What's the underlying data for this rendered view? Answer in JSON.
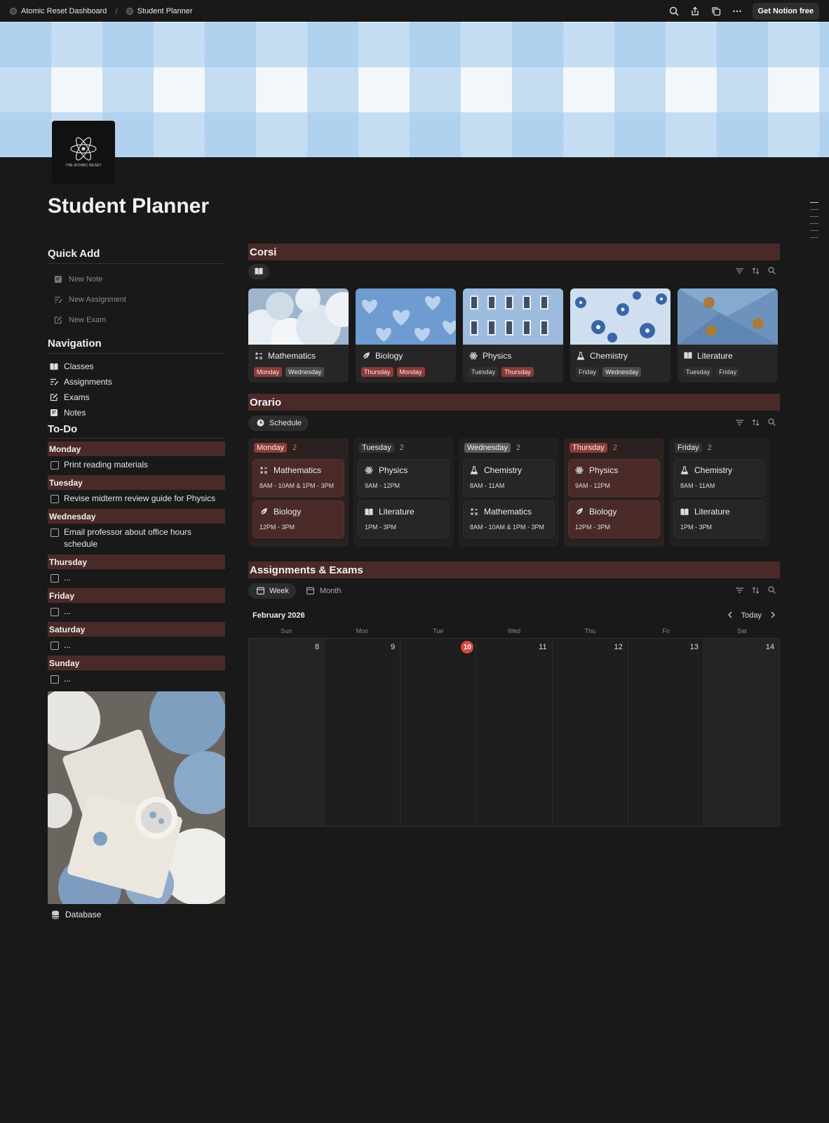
{
  "breadcrumb": {
    "parent": "Atomic Reset Dashboard",
    "current": "Student Planner"
  },
  "topbar": {
    "cta": "Get Notion free"
  },
  "page": {
    "title": "Student Planner",
    "logo_text": "THE ATOMIC RESET"
  },
  "quick_add": {
    "heading": "Quick Add",
    "items": [
      {
        "label": "New Note",
        "icon": "note-icon"
      },
      {
        "label": "New Assignment",
        "icon": "list-edit-icon"
      },
      {
        "label": "New Exam",
        "icon": "pencil-square-icon"
      }
    ]
  },
  "navigation": {
    "heading": "Navigation",
    "items": [
      {
        "label": "Classes",
        "icon": "book-icon"
      },
      {
        "label": "Assignments",
        "icon": "list-edit-icon"
      },
      {
        "label": "Exams",
        "icon": "pencil-square-icon"
      },
      {
        "label": "Notes",
        "icon": "note-icon"
      }
    ]
  },
  "todo": {
    "heading": "To-Do",
    "days": [
      {
        "day": "Monday",
        "tasks": [
          "Print reading materials"
        ]
      },
      {
        "day": "Tuesday",
        "tasks": [
          "Revise midterm review guide for Physics"
        ]
      },
      {
        "day": "Wednesday",
        "tasks": [
          "Email professor about office hours schedule"
        ]
      },
      {
        "day": "Thursday",
        "tasks": [
          "..."
        ]
      },
      {
        "day": "Friday",
        "tasks": [
          "..."
        ]
      },
      {
        "day": "Saturday",
        "tasks": [
          "..."
        ]
      },
      {
        "day": "Sunday",
        "tasks": [
          "..."
        ]
      }
    ]
  },
  "database_link": "Database",
  "corsi": {
    "heading": "Corsi",
    "cards": [
      {
        "name": "Mathematics",
        "icon": "math-operations-icon",
        "tags": [
          "Monday",
          "Wednesday"
        ],
        "tag_styles": [
          "red",
          "gray"
        ]
      },
      {
        "name": "Biology",
        "icon": "leaf-icon",
        "tags": [
          "Thursday",
          "Monday"
        ],
        "tag_styles": [
          "red",
          "red"
        ]
      },
      {
        "name": "Physics",
        "icon": "atom-icon",
        "tags": [
          "Tuesday",
          "Thursday"
        ],
        "tag_styles": [
          "dark",
          "red"
        ]
      },
      {
        "name": "Chemistry",
        "icon": "flask-icon",
        "tags": [
          "Friday",
          "Wednesday"
        ],
        "tag_styles": [
          "dark",
          "gray"
        ]
      },
      {
        "name": "Literature",
        "icon": "book-icon",
        "tags": [
          "Tuesday",
          "Friday"
        ],
        "tag_styles": [
          "dark",
          "dark"
        ]
      }
    ]
  },
  "orario": {
    "heading": "Orario",
    "view": "Schedule",
    "columns": [
      {
        "day": "Monday",
        "count": "2",
        "style": "red",
        "items": [
          {
            "name": "Mathematics",
            "icon": "math-operations-icon",
            "time": "8AM - 10AM & 1PM - 3PM"
          },
          {
            "name": "Biology",
            "icon": "leaf-icon",
            "time": "12PM - 3PM"
          }
        ]
      },
      {
        "day": "Tuesday",
        "count": "2",
        "style": "dark",
        "items": [
          {
            "name": "Physics",
            "icon": "atom-icon",
            "time": "9AM - 12PM"
          },
          {
            "name": "Literature",
            "icon": "book-icon",
            "time": "1PM - 3PM"
          }
        ]
      },
      {
        "day": "Wednesday",
        "count": "2",
        "style": "gray",
        "items": [
          {
            "name": "Chemistry",
            "icon": "flask-icon",
            "time": "8AM - 11AM"
          },
          {
            "name": "Mathematics",
            "icon": "math-operations-icon",
            "time": "8AM - 10AM & 1PM - 3PM"
          }
        ]
      },
      {
        "day": "Thursday",
        "count": "2",
        "style": "red",
        "items": [
          {
            "name": "Physics",
            "icon": "atom-icon",
            "time": "9AM - 12PM"
          },
          {
            "name": "Biology",
            "icon": "leaf-icon",
            "time": "12PM - 3PM"
          }
        ]
      },
      {
        "day": "Friday",
        "count": "2",
        "style": "dark",
        "items": [
          {
            "name": "Chemistry",
            "icon": "flask-icon",
            "time": "8AM - 11AM"
          },
          {
            "name": "Literature",
            "icon": "book-icon",
            "time": "1PM - 3PM"
          }
        ]
      }
    ]
  },
  "assignments": {
    "heading": "Assignments & Exams",
    "tabs": [
      "Week",
      "Month"
    ],
    "month_label": "February 2026",
    "today_label": "Today",
    "weekdays": [
      "Sun",
      "Mon",
      "Tue",
      "Wed",
      "Thu",
      "Fri",
      "Sat"
    ],
    "dates": [
      "8",
      "9",
      "10",
      "11",
      "12",
      "13",
      "14"
    ],
    "today": "10"
  },
  "colors": {
    "band": "#4a2a28",
    "tag_red": "#8e3a36",
    "today": "#d9483b"
  }
}
